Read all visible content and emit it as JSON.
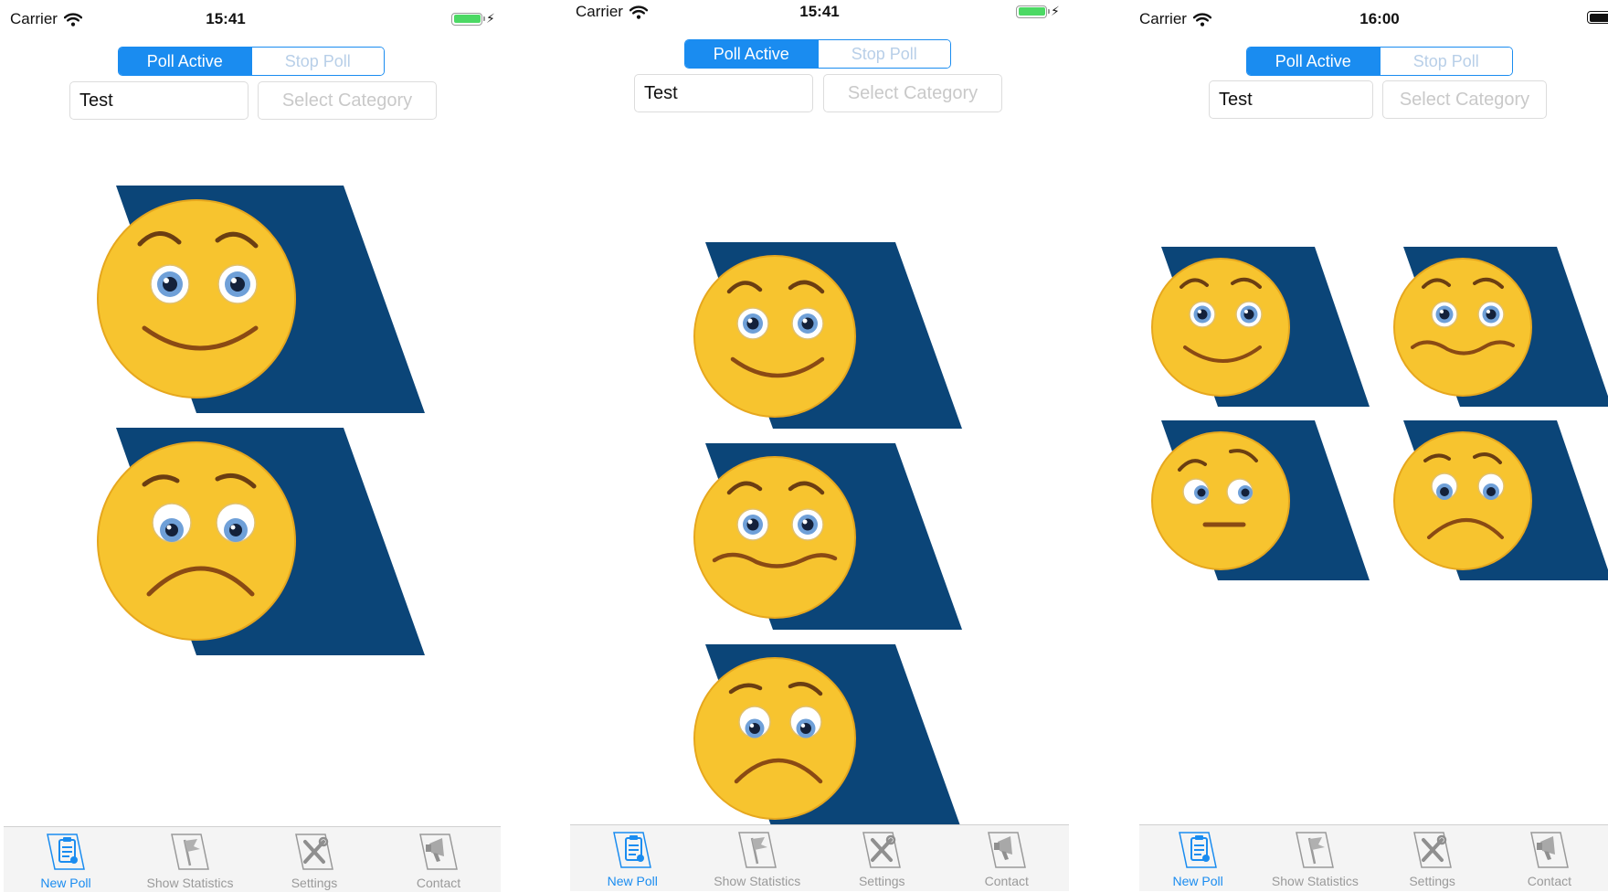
{
  "phones": [
    {
      "status": {
        "carrier": "Carrier",
        "time": "15:41",
        "battery_color": "#4cd964",
        "charging": true
      },
      "segmented": {
        "active_label": "Poll Active",
        "inactive_label": "Stop Poll"
      },
      "text_field_value": "Test",
      "select_placeholder": "Select Category",
      "faces": [
        "smile",
        "sad"
      ]
    },
    {
      "status": {
        "carrier": "Carrier",
        "time": "15:41",
        "battery_color": "#4cd964",
        "charging": true
      },
      "segmented": {
        "active_label": "Poll Active",
        "inactive_label": "Stop Poll"
      },
      "text_field_value": "Test",
      "select_placeholder": "Select Category",
      "faces": [
        "smile",
        "uneasy",
        "sad"
      ]
    },
    {
      "status": {
        "carrier": "Carrier",
        "time": "16:00",
        "battery_color": "#111111",
        "charging": false
      },
      "segmented": {
        "active_label": "Poll Active",
        "inactive_label": "Stop Poll"
      },
      "text_field_value": "Test",
      "select_placeholder": "Select Category",
      "faces": [
        "smile",
        "uneasy",
        "neutral",
        "sad"
      ]
    }
  ],
  "tabbar": [
    {
      "label": "New Poll",
      "icon": "clipboard-icon",
      "active": true
    },
    {
      "label": "Show Statistics",
      "icon": "flag-icon",
      "active": false
    },
    {
      "label": "Settings",
      "icon": "tools-icon",
      "active": false
    },
    {
      "label": "Contact",
      "icon": "megaphone-icon",
      "active": false
    }
  ],
  "colors": {
    "accent": "#1a8cf0",
    "card_navy": "#0b4578",
    "face_yellow": "#f7c42f",
    "face_outline": "#e6a71e",
    "mouth_brown": "#8a4a14",
    "tab_inactive": "#9a9a9a"
  }
}
